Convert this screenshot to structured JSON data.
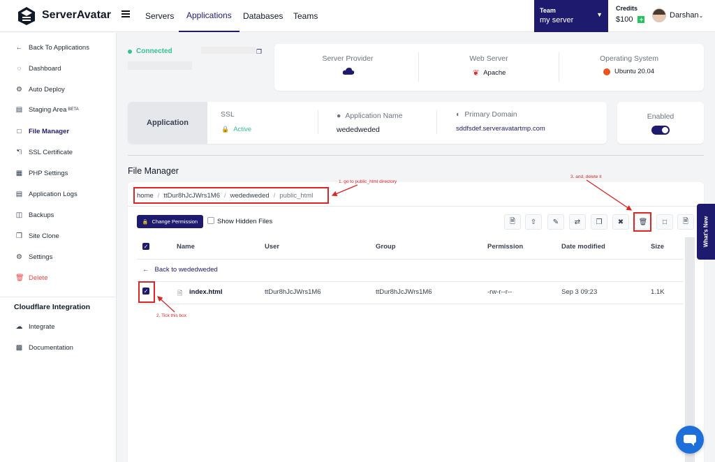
{
  "header": {
    "brand": "ServerAvatar",
    "nav": [
      "Servers",
      "Applications",
      "Databases",
      "Teams"
    ],
    "team_label": "Team",
    "team_value": "my server",
    "credits_label": "Credits",
    "credits_value": "$100",
    "user_name": "Darshan"
  },
  "sidebar": {
    "items": [
      {
        "label": "Back To Applications",
        "icon": "arrow-left-circle-icon"
      },
      {
        "label": "Dashboard",
        "icon": "dashboard-icon"
      },
      {
        "label": "Auto Deploy",
        "icon": "gear-icon"
      },
      {
        "label": "Staging Area",
        "icon": "staging-icon",
        "badge": "BETA"
      },
      {
        "label": "File Manager",
        "icon": "file-icon"
      },
      {
        "label": "SSL Certificate",
        "icon": "lock-icon"
      },
      {
        "label": "PHP Settings",
        "icon": "cubes-icon"
      },
      {
        "label": "Application Logs",
        "icon": "log-icon"
      },
      {
        "label": "Backups",
        "icon": "backup-icon"
      },
      {
        "label": "Site Clone",
        "icon": "clone-icon"
      },
      {
        "label": "Settings",
        "icon": "gear-icon"
      },
      {
        "label": "Delete",
        "icon": "trash-icon"
      }
    ],
    "section_title": "Cloudflare Integration",
    "section_items": [
      {
        "label": "Integrate",
        "icon": "cloud-icon"
      },
      {
        "label": "Documentation",
        "icon": "document-icon"
      }
    ]
  },
  "status": {
    "connected": "Connected"
  },
  "server_info": {
    "provider_label": "Server Provider",
    "web_server_label": "Web Server",
    "web_server_value": "Apache",
    "os_label": "Operating System",
    "os_value": "Ubuntu 20.04"
  },
  "app_info": {
    "tab": "Application",
    "ssl_label": "SSL",
    "ssl_value": "Active",
    "name_label": "Application Name",
    "name_value": "wededweded",
    "domain_label": "Primary Domain",
    "domain_value": "sddfsdef.serveravatartmp.com",
    "enabled_label": "Enabled",
    "enabled": true
  },
  "file_manager": {
    "title": "File Manager",
    "breadcrumb": [
      "home",
      "ttDur8hJcJWrs1M6",
      "wededweded",
      "public_html"
    ],
    "change_permission": "Change Permission",
    "show_hidden": "Show Hidden Files",
    "toolbar_icons": [
      "new-file-icon",
      "upload-icon",
      "edit-icon",
      "move-icon",
      "copy-icon",
      "compress-icon",
      "trash-icon",
      "extract-icon",
      "download-icon"
    ],
    "columns": [
      "Name",
      "User",
      "Group",
      "Permission",
      "Date modified",
      "Size"
    ],
    "back_label": "Back to wededweded",
    "rows": [
      {
        "name": "index.html",
        "user": "ttDur8hJcJWrs1M6",
        "group": "ttDur8hJcJWrs1M6",
        "permission": "-rw-r--r--",
        "modified": "Sep 3 09:23",
        "size": "1.1K",
        "checked": true
      }
    ]
  },
  "annotations": {
    "step1": "1. go to public_html directory",
    "step2": "2. Tick this box",
    "step3": "3. and, delete it"
  },
  "whats_new": "What's New",
  "colors": {
    "primary": "#1e1b6e",
    "success": "#34c38f",
    "danger": "#ef4444",
    "annotation": "#dc2626"
  }
}
